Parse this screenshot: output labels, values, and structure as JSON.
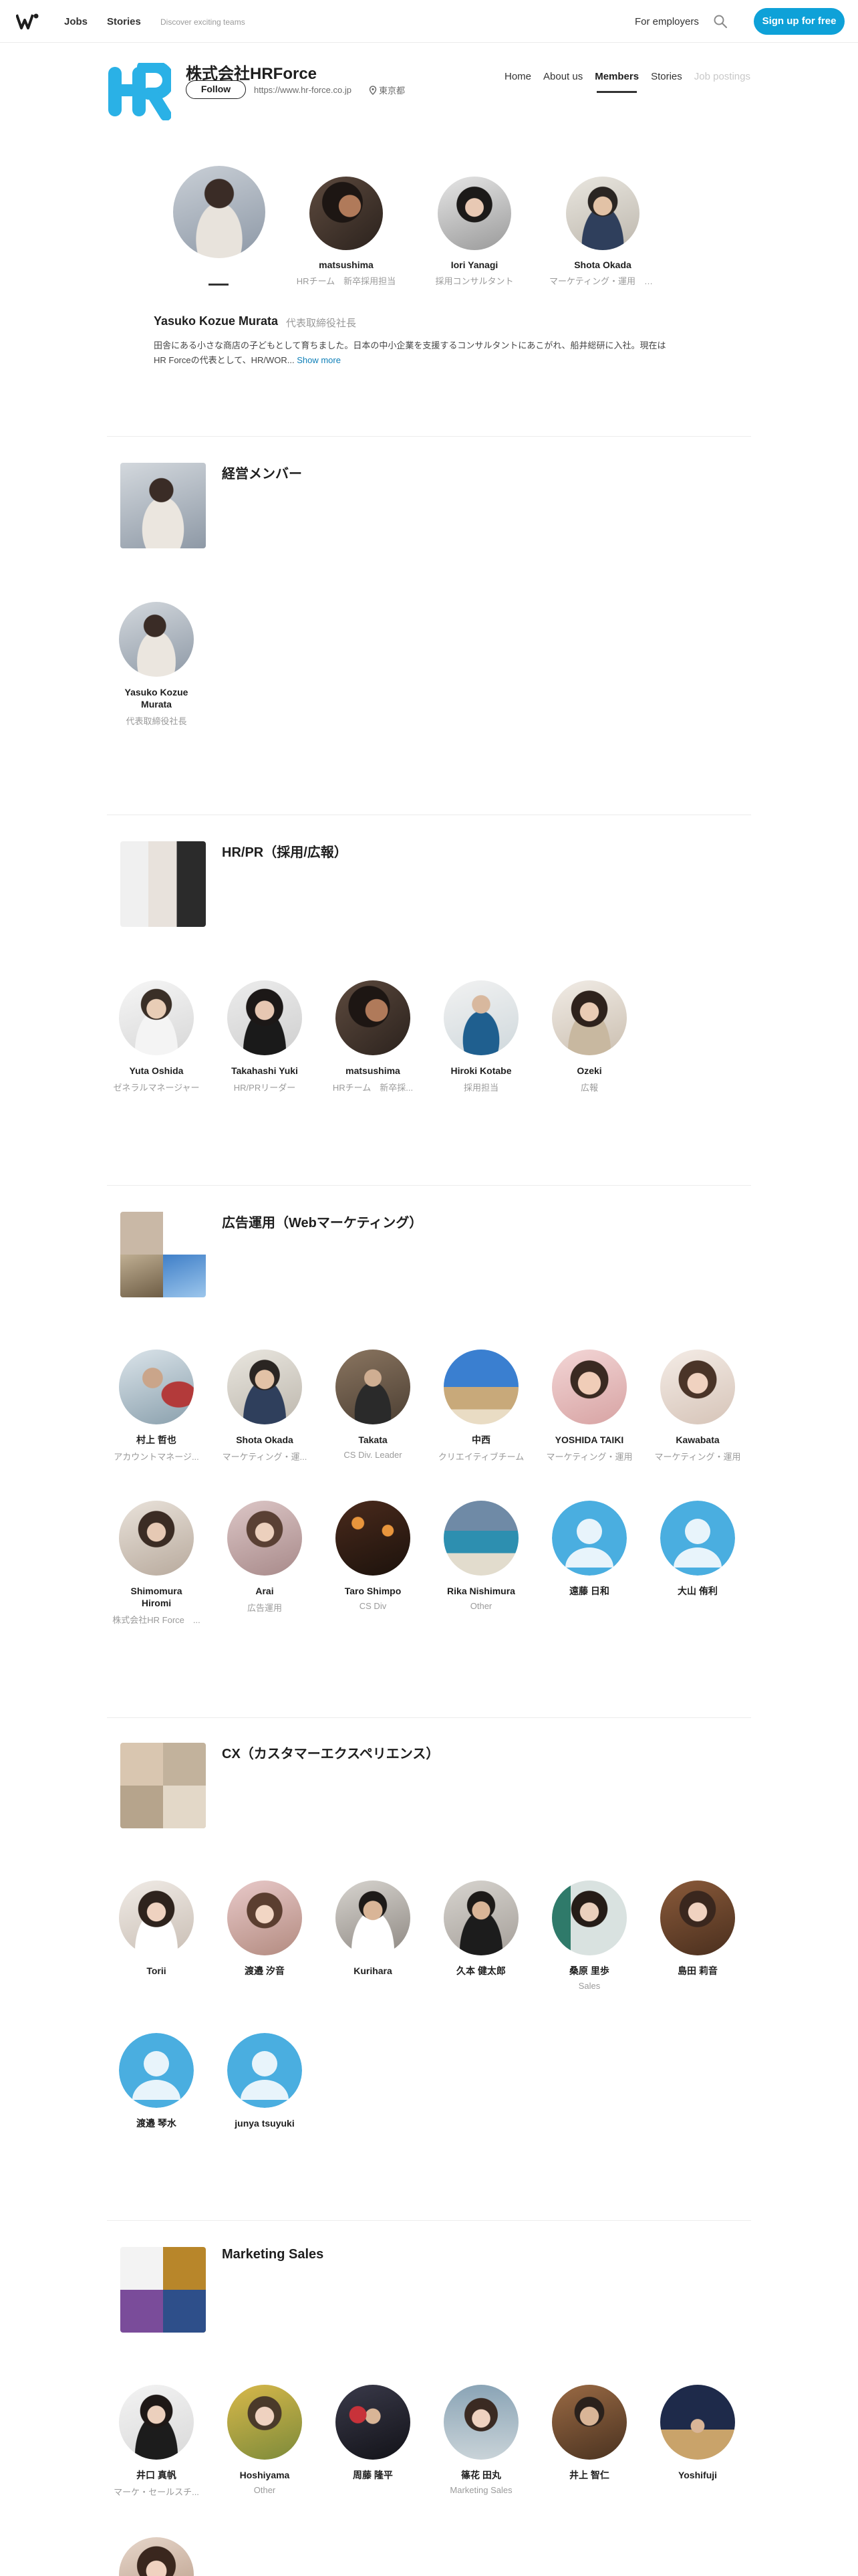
{
  "nav": {
    "jobs": "Jobs",
    "stories": "Stories",
    "tagline": "Discover exciting teams",
    "employers": "For employers",
    "signup": "Sign up for free",
    "accent": "#0ea1d8"
  },
  "company": {
    "name": "株式会社HRForce",
    "follow": "Follow",
    "url": "https://www.hr-force.co.jp",
    "location": "東京都",
    "logo_color": "#2ab1e6",
    "tabs": [
      "Home",
      "About us",
      "Members",
      "Stories",
      "Job postings"
    ],
    "active_tab": "Members"
  },
  "featured": [
    {
      "name": "",
      "role": ""
    },
    {
      "name": "matsushima",
      "role": "HRチーム　新卒採用担当"
    },
    {
      "name": "Iori Yanagi",
      "role": "採用コンサルタント"
    },
    {
      "name": "Shota Okada",
      "role": "マーケティング・運用　マ..."
    }
  ],
  "leader": {
    "name": "Yasuko Kozue Murata",
    "title": "代表取締役社長",
    "bio": "田舎にある小さな商店の子どもとして育ちました。日本の中小企業を支援するコンサルタントにあこがれ、船井総研に入社。現在はHR Forceの代表として、HR/WOR...",
    "show_more": "Show more"
  },
  "sections": [
    {
      "title": "経営メンバー",
      "members": [
        {
          "name": "Yasuko Kozue Murata",
          "role": "代表取締役社長"
        }
      ]
    },
    {
      "title": "HR/PR（採用/広報）",
      "members": [
        {
          "name": "Yuta Oshida",
          "role": "ゼネラルマネージャー"
        },
        {
          "name": "Takahashi Yuki",
          "role": "HR/PRリーダー"
        },
        {
          "name": "matsushima",
          "role": "HRチーム　新卒採..."
        },
        {
          "name": "Hiroki Kotabe",
          "role": "採用担当"
        },
        {
          "name": "Ozeki",
          "role": "広報"
        }
      ]
    },
    {
      "title": "広告運用（Webマーケティング）",
      "members": [
        {
          "name": "村上 哲也",
          "role": "アカウントマネージ..."
        },
        {
          "name": "Shota Okada",
          "role": "マーケティング・運..."
        },
        {
          "name": "Takata",
          "role": "CS Div. Leader"
        },
        {
          "name": "中西",
          "role": "クリエイティブチーム"
        },
        {
          "name": "YOSHIDA TAIKI",
          "role": "マーケティング・運用"
        },
        {
          "name": "Kawabata",
          "role": "マーケティング・運用"
        },
        {
          "name": "Shimomura Hiromi",
          "role": "株式会社HR Force　..."
        },
        {
          "name": "Arai",
          "role": "広告運用"
        },
        {
          "name": "Taro Shimpo",
          "role": "CS Div"
        },
        {
          "name": "Rika Nishimura",
          "role": "Other"
        },
        {
          "name": "遠藤 日和",
          "role": ""
        },
        {
          "name": "大山 侑利",
          "role": ""
        }
      ]
    },
    {
      "title": "CX（カスタマーエクスペリエンス）",
      "members": [
        {
          "name": "Torii",
          "role": ""
        },
        {
          "name": "渡邉 汐音",
          "role": ""
        },
        {
          "name": "Kurihara",
          "role": ""
        },
        {
          "name": "久本 健太郎",
          "role": ""
        },
        {
          "name": "桑原 里歩",
          "role": "Sales"
        },
        {
          "name": "島田 莉音",
          "role": ""
        },
        {
          "name": "渡邉 琴水",
          "role": ""
        },
        {
          "name": "junya tsuyuki",
          "role": ""
        }
      ]
    },
    {
      "title": "Marketing Sales",
      "members": [
        {
          "name": "井口 真帆",
          "role": "マーケ・セールスチ..."
        },
        {
          "name": "Hoshiyama",
          "role": "Other"
        },
        {
          "name": "周藤 隆平",
          "role": ""
        },
        {
          "name": "篠花 田丸",
          "role": "Marketing Sales"
        },
        {
          "name": "井上 智仁",
          "role": ""
        },
        {
          "name": "Yoshifuji",
          "role": ""
        },
        {
          "name": "",
          "role": ""
        }
      ]
    }
  ]
}
